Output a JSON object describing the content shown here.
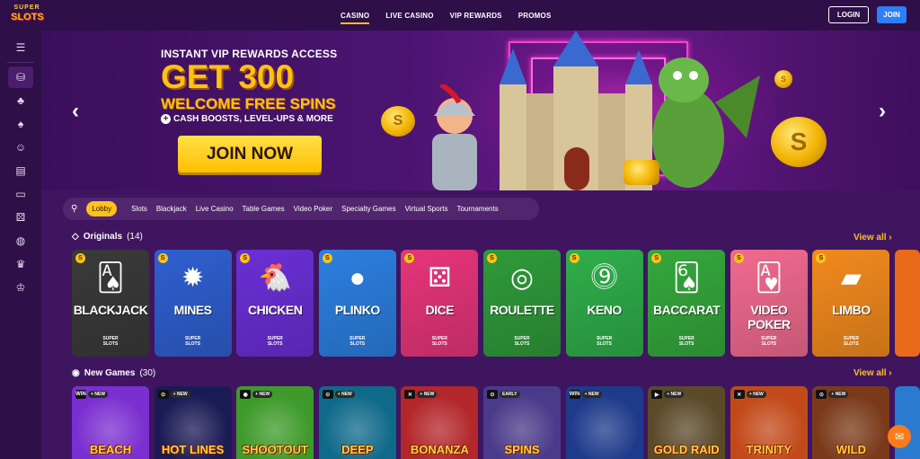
{
  "logo": {
    "line1": "SUPER",
    "line2": "SLOTS"
  },
  "nav": [
    {
      "label": "CASINO",
      "active": true
    },
    {
      "label": "LIVE CASINO",
      "active": false
    },
    {
      "label": "VIP REWARDS",
      "active": false
    },
    {
      "label": "PROMOS",
      "active": false
    }
  ],
  "auth": {
    "login_label": "LOGIN",
    "join_label": "JOIN"
  },
  "sidebar": {
    "menu_icon": "hamburger-icon",
    "items": [
      {
        "icon": "chips-icon",
        "glyph": "⛁",
        "active": true
      },
      {
        "icon": "cherries-icon",
        "glyph": "♣",
        "active": false
      },
      {
        "icon": "spade-icon",
        "glyph": "♠",
        "active": false
      },
      {
        "icon": "dealer-icon",
        "glyph": "☺",
        "active": false
      },
      {
        "icon": "cards-icon",
        "glyph": "▤",
        "active": false
      },
      {
        "icon": "laptop-icon",
        "glyph": "▭",
        "active": false
      },
      {
        "icon": "dice-icon",
        "glyph": "⚄",
        "active": false
      },
      {
        "icon": "basketball-icon",
        "glyph": "◍",
        "active": false
      },
      {
        "icon": "trophy-icon",
        "glyph": "♛",
        "active": false
      },
      {
        "icon": "crown-icon",
        "glyph": "♔",
        "active": false
      }
    ]
  },
  "banner": {
    "subtitle": "INSTANT VIP REWARDS ACCESS",
    "headline": "GET 300",
    "headline2": "WELCOME FREE SPINS",
    "cash_text": "CASH BOOSTS, LEVEL-UPS & MORE",
    "cta_label": "JOIN NOW",
    "prev_glyph": "‹",
    "next_glyph": "›",
    "coin_glyph": "S"
  },
  "filters": {
    "search_icon": "⚲",
    "items": [
      {
        "label": "Lobby",
        "active": true
      },
      {
        "label": "Slots",
        "active": false
      },
      {
        "label": "Blackjack",
        "active": false
      },
      {
        "label": "Live Casino",
        "active": false
      },
      {
        "label": "Table Games",
        "active": false
      },
      {
        "label": "Video Poker",
        "active": false
      },
      {
        "label": "Specialty Games",
        "active": false
      },
      {
        "label": "Virtual Sports",
        "active": false
      },
      {
        "label": "Tournaments",
        "active": false
      }
    ]
  },
  "originals": {
    "title": "Originals",
    "count": "(14)",
    "view_all": "View all ›",
    "brand_line1": "SUPER",
    "brand_line2": "SLOTS",
    "games": [
      {
        "name": "BLACKJACK",
        "art": "🂡",
        "color": "#3a3a3a"
      },
      {
        "name": "MINES",
        "art": "✹",
        "color": "#2f5fd0"
      },
      {
        "name": "CHICKEN",
        "art": "🐔",
        "color": "#6a2fd6"
      },
      {
        "name": "PLINKO",
        "art": "●",
        "color": "#2c7fe0"
      },
      {
        "name": "DICE",
        "art": "⚄",
        "color": "#e6357a"
      },
      {
        "name": "ROULETTE",
        "art": "◎",
        "color": "#2f9a3a"
      },
      {
        "name": "KENO",
        "art": "⓽",
        "color": "#2fae4a"
      },
      {
        "name": "BACCARAT",
        "art": "🂦",
        "color": "#35a83c"
      },
      {
        "name": "VIDEO POKER",
        "art": "🂱",
        "color": "#f06a8f"
      },
      {
        "name": "LIMBO",
        "art": "▰",
        "color": "#f28a1e"
      }
    ]
  },
  "new_games": {
    "title": "New Games",
    "count": "(30)",
    "view_all": "View all ›",
    "new_tag": "+ NEW",
    "early_tag": "EARLY",
    "games": [
      {
        "title": "BEACH",
        "prov": "WIN",
        "tag": "+ NEW",
        "color": "#7a2fd0"
      },
      {
        "title": "HOT LINES",
        "prov": "⊙",
        "tag": "+ NEW",
        "color": "#1a1a55"
      },
      {
        "title": "SHOOTOUT",
        "prov": "◉",
        "tag": "+ NEW",
        "color": "#3e9a2a"
      },
      {
        "title": "DEEP",
        "prov": "⊙",
        "tag": "+ NEW",
        "color": "#0f6a8a"
      },
      {
        "title": "BONANZA",
        "prov": "✕",
        "tag": "+ NEW",
        "color": "#b3262a"
      },
      {
        "title": "SPINS",
        "prov": "⊙",
        "tag": "EARLY",
        "color": "#4a3a8a"
      },
      {
        "title": "",
        "prov": "WIN",
        "tag": "+ NEW",
        "color": "#1e3a8a"
      },
      {
        "title": "GOLD RAID",
        "prov": "▶",
        "tag": "+ NEW",
        "color": "#5a4a2a"
      },
      {
        "title": "TRINITY",
        "prov": "✕",
        "tag": "+ NEW",
        "color": "#c24a1a"
      },
      {
        "title": "WILD",
        "prov": "⊙",
        "tag": "+ NEW",
        "color": "#7a3a1a"
      }
    ]
  },
  "chat_icon": "✉"
}
